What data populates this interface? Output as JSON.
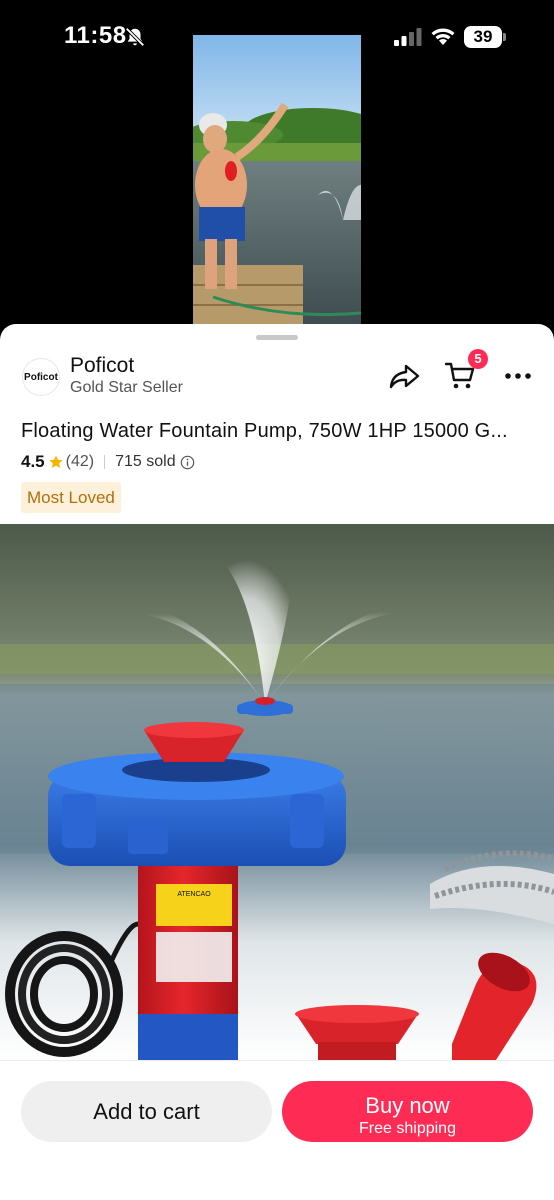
{
  "status_bar": {
    "time": "11:58",
    "battery": "39",
    "icons": [
      "bell-off-icon",
      "signal-icon",
      "wifi-icon",
      "battery-icon"
    ]
  },
  "video": {
    "icon": "video-thumbnail"
  },
  "seller": {
    "logo_text": "Poficot",
    "name": "Poficot",
    "badge": "Gold Star Seller"
  },
  "header_actions": {
    "cart_count": "5",
    "icons": [
      "share-icon",
      "cart-icon",
      "more-icon"
    ]
  },
  "product": {
    "title": "Floating Water Fountain Pump, 750W 1HP 15000 G...",
    "rating": "4.5",
    "review_count": "(42)",
    "sold": "715 sold",
    "badge": "Most Loved",
    "image_label": "ATENCAO"
  },
  "actions": {
    "add_to_cart": "Add to cart",
    "buy_now": "Buy now",
    "buy_now_sub": "Free shipping"
  },
  "colors": {
    "accent": "#fe2c55",
    "badge_bg": "#fef1dc",
    "badge_text": "#b0700a",
    "star": "#f5b400"
  }
}
